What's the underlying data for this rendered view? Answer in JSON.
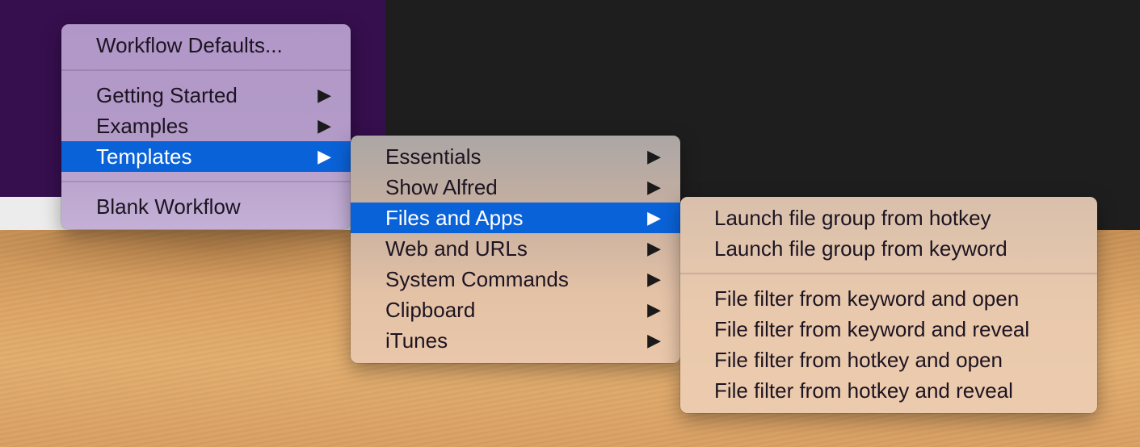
{
  "main_menu": {
    "items": [
      {
        "label": "Workflow Defaults...",
        "has_submenu": false
      },
      {
        "label": "Getting Started",
        "has_submenu": true
      },
      {
        "label": "Examples",
        "has_submenu": true
      },
      {
        "label": "Templates",
        "has_submenu": true,
        "selected": true
      },
      {
        "label": "Blank Workflow",
        "has_submenu": false
      }
    ]
  },
  "templates_menu": {
    "items": [
      {
        "label": "Essentials",
        "has_submenu": true
      },
      {
        "label": "Show Alfred",
        "has_submenu": true
      },
      {
        "label": "Files and Apps",
        "has_submenu": true,
        "selected": true
      },
      {
        "label": "Web and URLs",
        "has_submenu": true
      },
      {
        "label": "System Commands",
        "has_submenu": true
      },
      {
        "label": "Clipboard",
        "has_submenu": true
      },
      {
        "label": "iTunes",
        "has_submenu": true
      }
    ]
  },
  "files_and_apps_menu": {
    "items": [
      {
        "label": "Launch file group from hotkey"
      },
      {
        "label": "Launch file group from keyword"
      },
      {
        "label": "File filter from keyword and open"
      },
      {
        "label": "File filter from keyword and reveal"
      },
      {
        "label": "File filter from hotkey and open"
      },
      {
        "label": "File filter from hotkey and reveal"
      }
    ]
  },
  "icons": {
    "submenu_arrow": "▶"
  },
  "colors": {
    "selection": "#0a62d8",
    "wallpaper_purple": "#360f4e",
    "window_dark": "#1e1e1e"
  }
}
